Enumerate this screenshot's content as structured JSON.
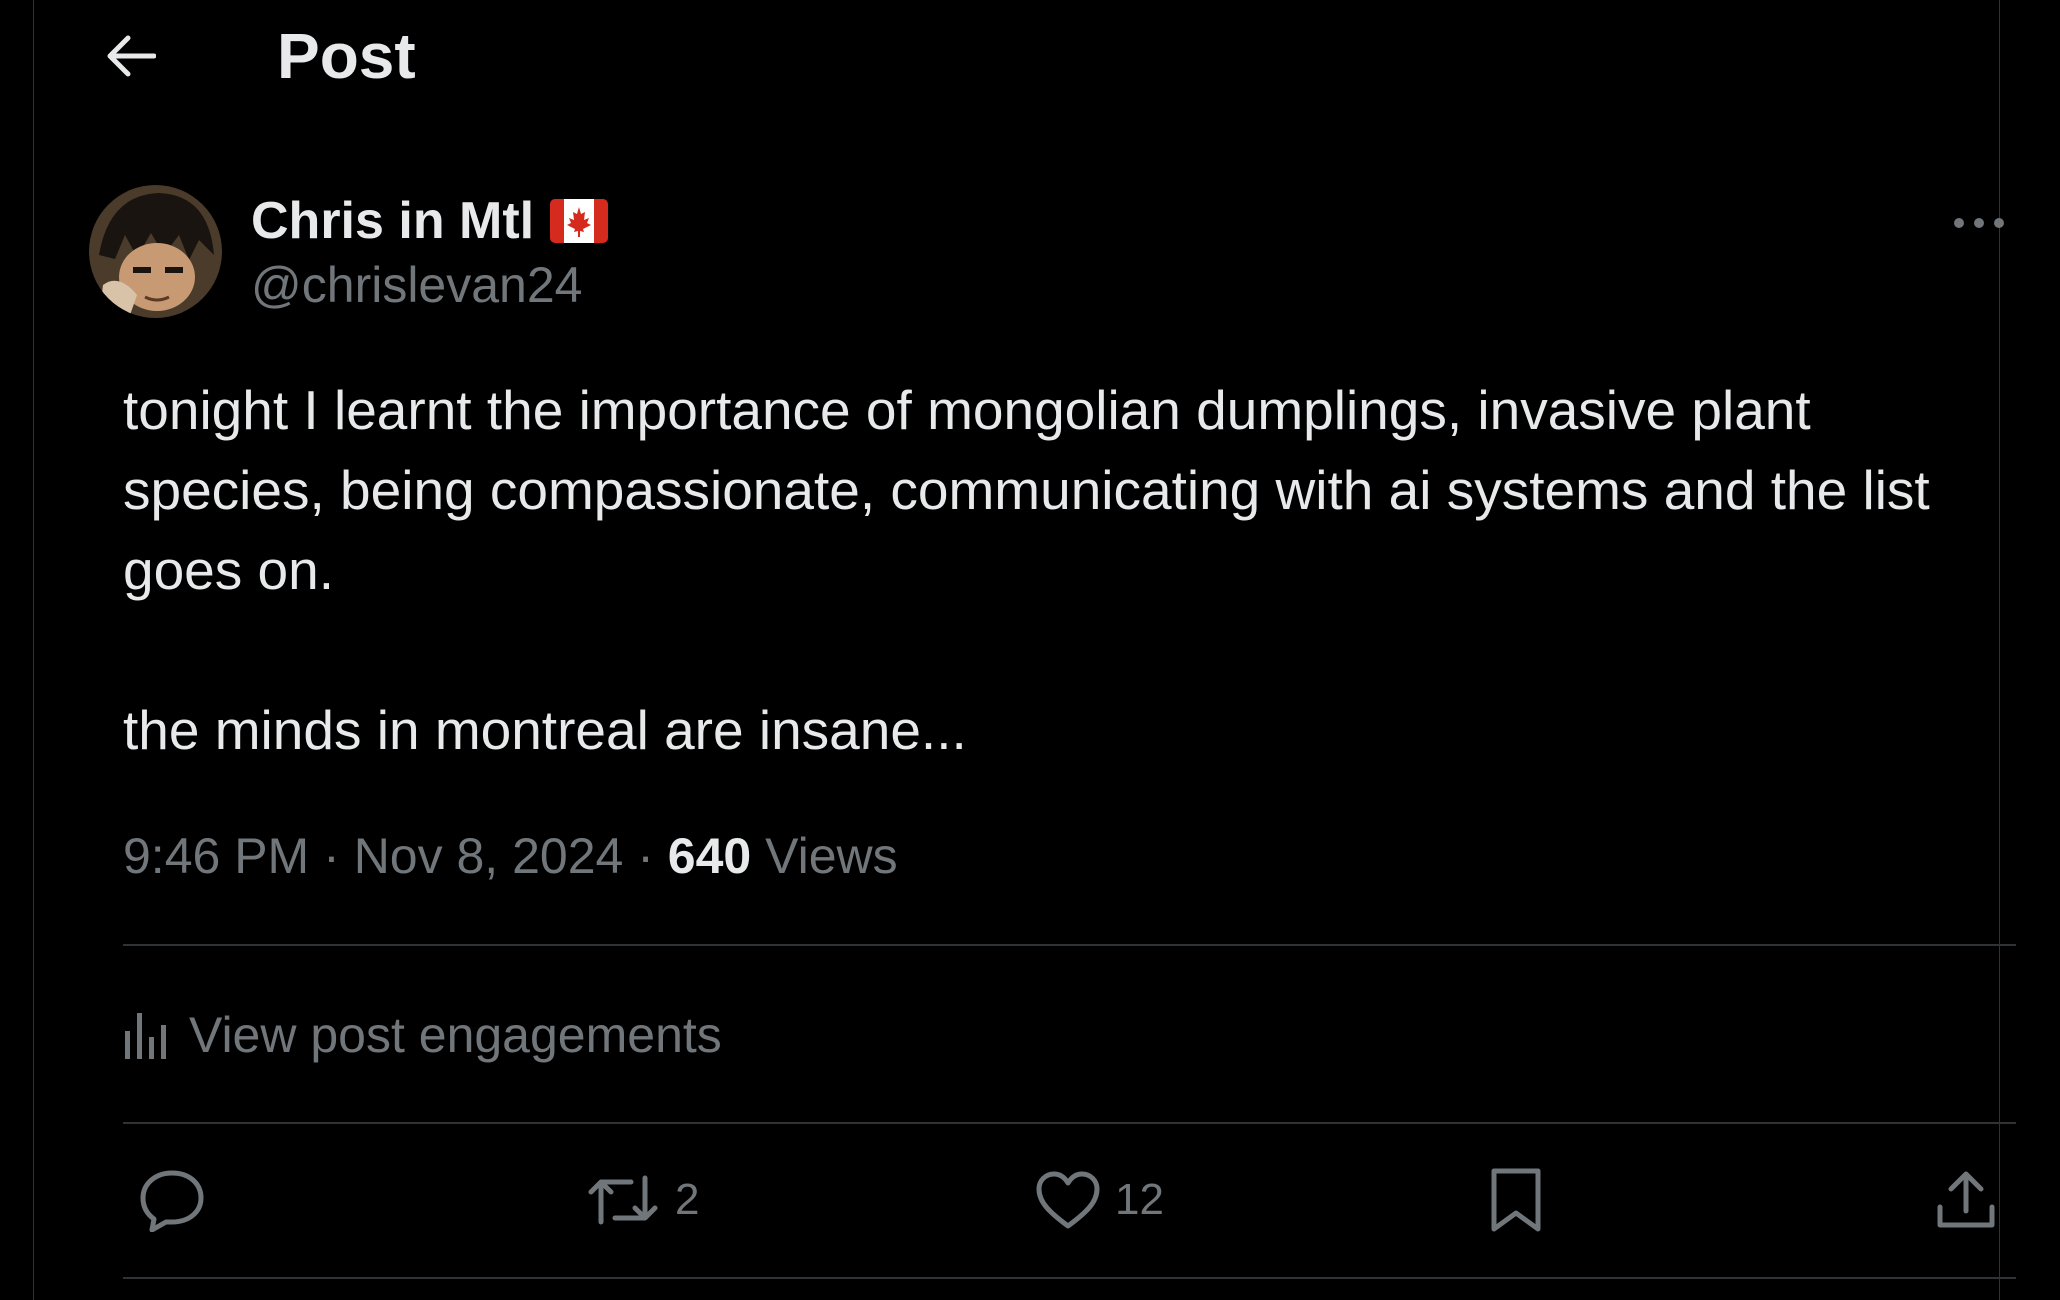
{
  "header": {
    "title": "Post"
  },
  "author": {
    "display_name": "Chris in Mtl",
    "flag_icon": "canada-flag-icon",
    "handle": "@chrislevan24"
  },
  "post": {
    "text": "tonight I learnt the importance of mongolian dumplings, invasive plant species, being compassionate, communicating with ai systems and the list goes on.\n\nthe minds in montreal are insane..."
  },
  "meta": {
    "time": "9:46 PM",
    "separator": "·",
    "date": "Nov 8, 2024",
    "views_count": "640",
    "views_label": "Views"
  },
  "engagements_link": "View post engagements",
  "actions": {
    "reply_count": "",
    "repost_count": "2",
    "like_count": "12"
  },
  "colors": {
    "background": "#000000",
    "primary_text": "#e7e9ea",
    "secondary_text": "#71767b",
    "divider": "#2f3336"
  }
}
